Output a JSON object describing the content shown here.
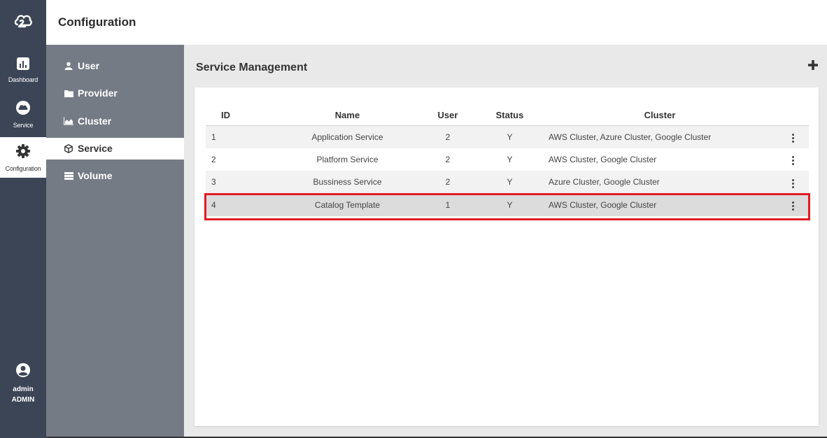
{
  "header": {
    "title": "Configuration"
  },
  "rail": {
    "items": [
      {
        "label": "Dashboard"
      },
      {
        "label": "Service"
      },
      {
        "label": "Configuration"
      }
    ],
    "user": {
      "name": "admin",
      "role": "ADMIN"
    }
  },
  "subnav": {
    "items": [
      {
        "label": "User",
        "icon": "user-icon"
      },
      {
        "label": "Provider",
        "icon": "folder-icon"
      },
      {
        "label": "Cluster",
        "icon": "area-chart-icon"
      },
      {
        "label": "Service",
        "icon": "cube-icon"
      },
      {
        "label": "Volume",
        "icon": "server-icon"
      }
    ],
    "active": "Service"
  },
  "main": {
    "title": "Service Management"
  },
  "table": {
    "columns": [
      "ID",
      "Name",
      "User",
      "Status",
      "Cluster"
    ],
    "rows": [
      {
        "id": "1",
        "name": "Application Service",
        "user": "2",
        "status": "Y",
        "cluster": "AWS Cluster, Azure Cluster, Google Cluster"
      },
      {
        "id": "2",
        "name": "Platform Service",
        "user": "2",
        "status": "Y",
        "cluster": "AWS Cluster, Google Cluster"
      },
      {
        "id": "3",
        "name": "Bussiness Service",
        "user": "2",
        "status": "Y",
        "cluster": "Azure Cluster, Google Cluster"
      },
      {
        "id": "4",
        "name": "Catalog Template",
        "user": "1",
        "status": "Y",
        "cluster": "AWS Cluster, Google Cluster"
      }
    ],
    "selected_row": "4"
  },
  "colors": {
    "rail": "#3c4556",
    "subnav": "#747b85",
    "highlight": "#e01b24"
  }
}
